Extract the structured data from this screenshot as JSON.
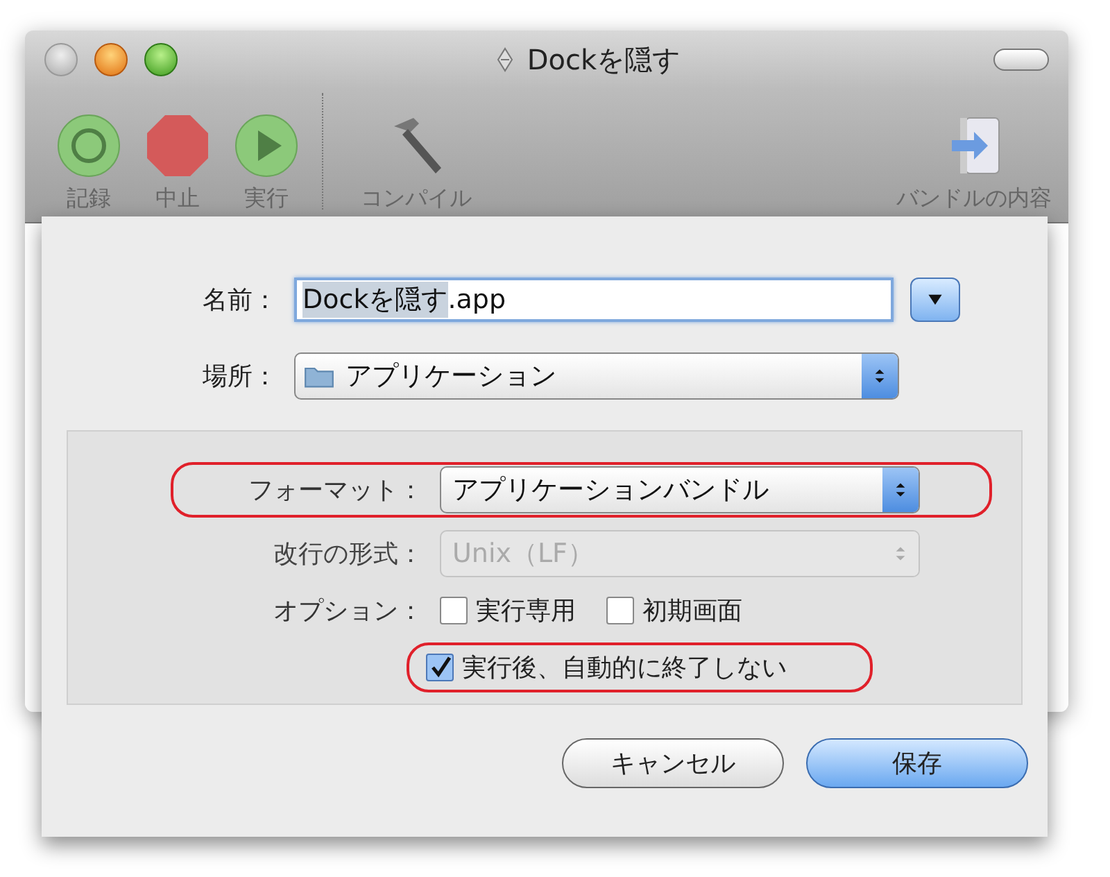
{
  "window": {
    "title": "Dockを隠す"
  },
  "toolbar": [
    {
      "kind": "record",
      "label": "記録"
    },
    {
      "kind": "stop",
      "label": "中止"
    },
    {
      "kind": "run",
      "label": "実行"
    },
    {
      "kind": "compile",
      "label": "コンパイル"
    },
    {
      "kind": "bundle",
      "label": "バンドルの内容"
    }
  ],
  "save_sheet": {
    "name": {
      "label": "名前：",
      "selected_text": "Dockを隠す",
      "text": ".app"
    },
    "location": {
      "label": "場所：",
      "value": "アプリケーション"
    },
    "format": {
      "label": "フォーマット：",
      "value": "アプリケーションバンドル",
      "disabled": false,
      "highlighted": true
    },
    "line_endings": {
      "label": "改行の形式：",
      "value": "Unix（LF）",
      "disabled": true,
      "highlighted": false
    },
    "options": {
      "label": "オプション：",
      "checkboxes": [
        {
          "label": "実行専用",
          "checked": false,
          "highlighted": false
        },
        {
          "label": "初期画面",
          "checked": false,
          "highlighted": false
        },
        {
          "label": "実行後、自動的に終了しない",
          "checked": true,
          "highlighted": true
        }
      ]
    },
    "buttons": [
      {
        "label": "キャンセル",
        "default": false
      },
      {
        "label": "保存",
        "default": true
      }
    ]
  }
}
